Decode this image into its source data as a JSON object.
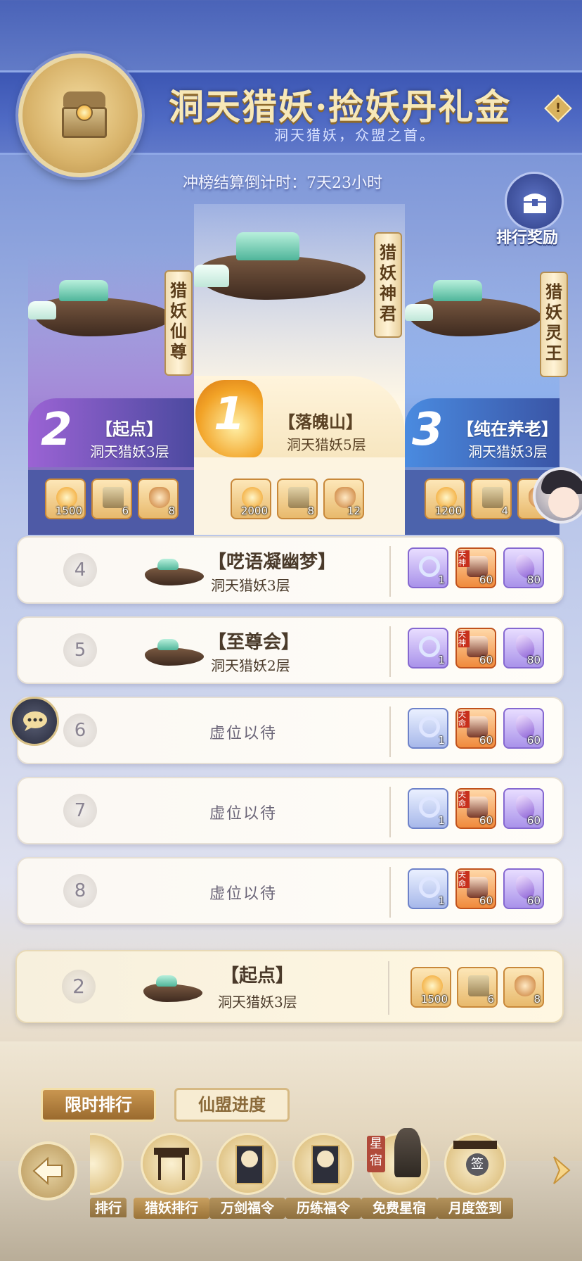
{
  "header": {
    "title": "洞天猎妖·捡妖丹礼金",
    "subtitle": "洞天猎妖，众盟之首。",
    "info_icon": "!",
    "countdown": "冲榜结算倒计时：7天23小时",
    "reward_button_label": "排行奖励"
  },
  "podium": [
    {
      "rank": "2",
      "guild": "【起点】",
      "level": "洞天猎妖3层",
      "scroll_title": "猎妖仙尊",
      "rewards": [
        {
          "icon": "coin",
          "qty": "1500"
        },
        {
          "icon": "chest",
          "qty": "6"
        },
        {
          "icon": "bag",
          "qty": "8"
        }
      ]
    },
    {
      "rank": "1",
      "guild": "【落魄山】",
      "level": "洞天猎妖5层",
      "scroll_title": "猎妖神君",
      "rewards": [
        {
          "icon": "coin",
          "qty": "2000"
        },
        {
          "icon": "chest",
          "qty": "8"
        },
        {
          "icon": "bag",
          "qty": "12"
        }
      ]
    },
    {
      "rank": "3",
      "guild": "【纯在养老】",
      "level": "洞天猎妖3层",
      "scroll_title": "猎妖灵王",
      "rewards": [
        {
          "icon": "coin",
          "qty": "1200"
        },
        {
          "icon": "chest",
          "qty": "4"
        },
        {
          "icon": "bag",
          "qty": ""
        }
      ]
    }
  ],
  "rows": [
    {
      "rank": "4",
      "guild": "【呓语凝幽梦】",
      "level": "洞天猎妖3层",
      "empty": "",
      "rewards": [
        {
          "icon": "ring",
          "qty": "1"
        },
        {
          "icon": "portrait",
          "qty": "60",
          "tag": "天神"
        },
        {
          "icon": "crystal",
          "qty": "80"
        }
      ]
    },
    {
      "rank": "5",
      "guild": "【至尊会】",
      "level": "洞天猎妖2层",
      "empty": "",
      "rewards": [
        {
          "icon": "ring",
          "qty": "1"
        },
        {
          "icon": "portrait",
          "qty": "60",
          "tag": "天神"
        },
        {
          "icon": "crystal",
          "qty": "80"
        }
      ]
    },
    {
      "rank": "6",
      "guild": "",
      "level": "",
      "empty": "虚位以待",
      "rewards": [
        {
          "icon": "ring",
          "qty": "1"
        },
        {
          "icon": "portrait",
          "qty": "60",
          "tag": "天命"
        },
        {
          "icon": "crystal",
          "qty": "60"
        }
      ]
    },
    {
      "rank": "7",
      "guild": "",
      "level": "",
      "empty": "虚位以待",
      "rewards": [
        {
          "icon": "ring",
          "qty": "1"
        },
        {
          "icon": "portrait",
          "qty": "60",
          "tag": "天命"
        },
        {
          "icon": "crystal",
          "qty": "60"
        }
      ]
    },
    {
      "rank": "8",
      "guild": "",
      "level": "",
      "empty": "虚位以待",
      "rewards": [
        {
          "icon": "ring",
          "qty": "1"
        },
        {
          "icon": "portrait",
          "qty": "60",
          "tag": "天命"
        },
        {
          "icon": "crystal",
          "qty": "60"
        }
      ]
    }
  ],
  "my_guild": {
    "rank": "2",
    "guild": "【起点】",
    "level": "洞天猎妖3层",
    "rewards": [
      {
        "icon": "coin",
        "qty": "1500"
      },
      {
        "icon": "chest",
        "qty": "6"
      },
      {
        "icon": "bag",
        "qty": "8"
      }
    ]
  },
  "tabs": {
    "active": "限时排行",
    "other": "仙盟进度"
  },
  "nav": [
    {
      "label": "排行",
      "icon": "partial-icon"
    },
    {
      "label": "猎妖排行",
      "icon": "gate-icon"
    },
    {
      "label": "万剑福令",
      "icon": "fortune-book-icon"
    },
    {
      "label": "历练福令",
      "icon": "fortune-book-icon"
    },
    {
      "label": "免费星宿",
      "icon": "dragon-statue-icon",
      "badge": "星宿"
    },
    {
      "label": "月度签到",
      "icon": "sign-icon",
      "badge": "签"
    }
  ]
}
